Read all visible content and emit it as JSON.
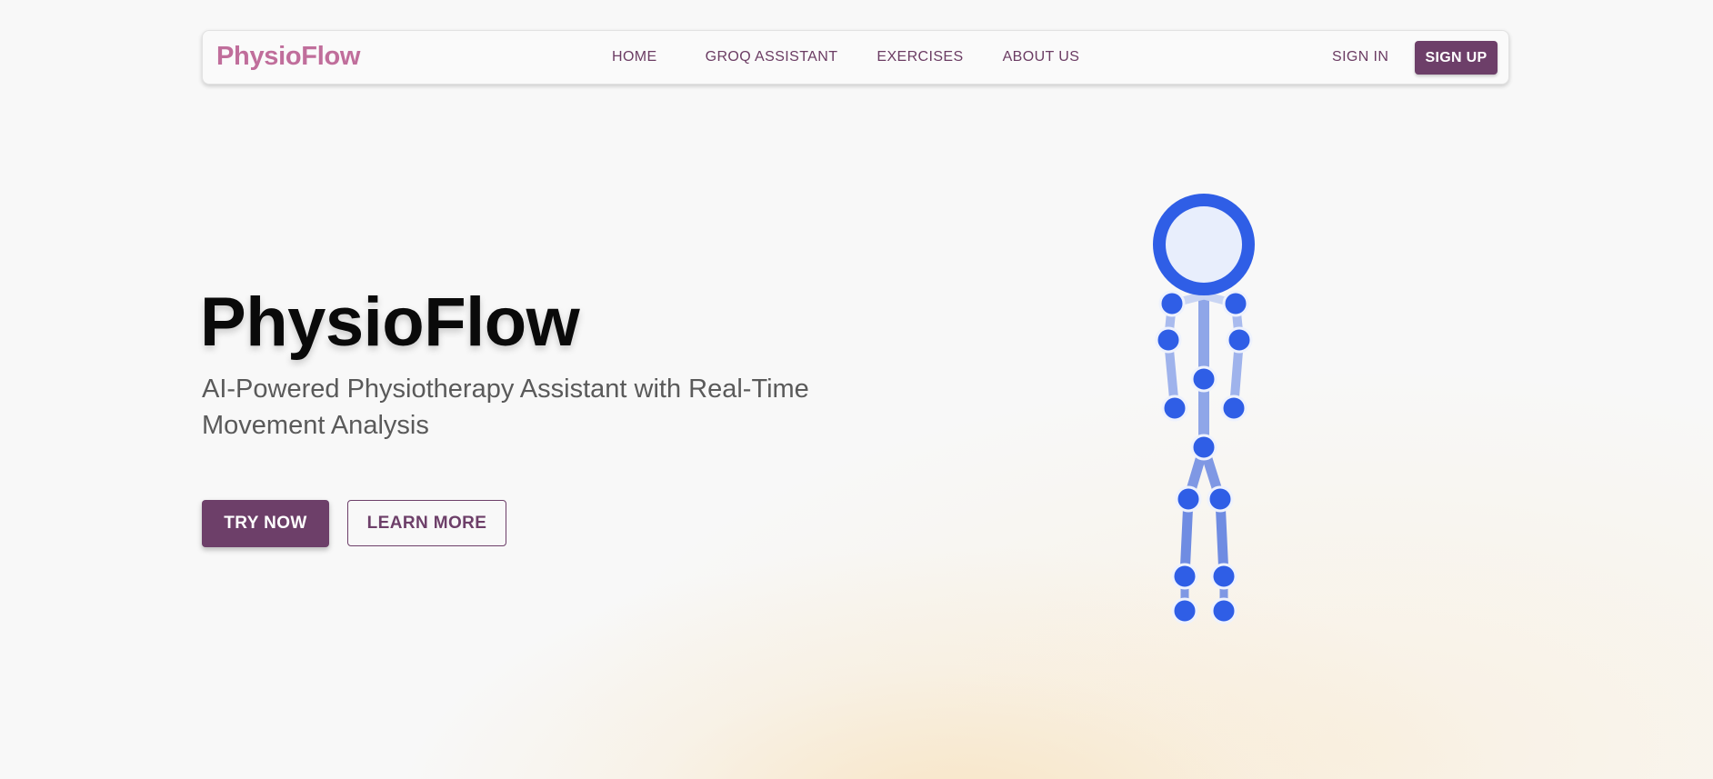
{
  "navbar": {
    "brand": "PhysioFlow",
    "links": [
      {
        "label": "HOME"
      },
      {
        "label": "GROQ ASSISTANT"
      },
      {
        "label": "EXERCISES"
      },
      {
        "label": "ABOUT US"
      }
    ],
    "sign_in": "SIGN IN",
    "sign_up": "SIGN UP"
  },
  "hero": {
    "title": "PhysioFlow",
    "subtitle": "AI-Powered Physiotherapy Assistant with Real-Time Movement Analysis",
    "primary_button": "TRY NOW",
    "secondary_button": "LEARN MORE"
  },
  "colors": {
    "brand": "#c06e9b",
    "accent": "#6d3f69",
    "skeleton_joint": "#2f5ee6",
    "skeleton_bone": "#8fa6e8"
  }
}
